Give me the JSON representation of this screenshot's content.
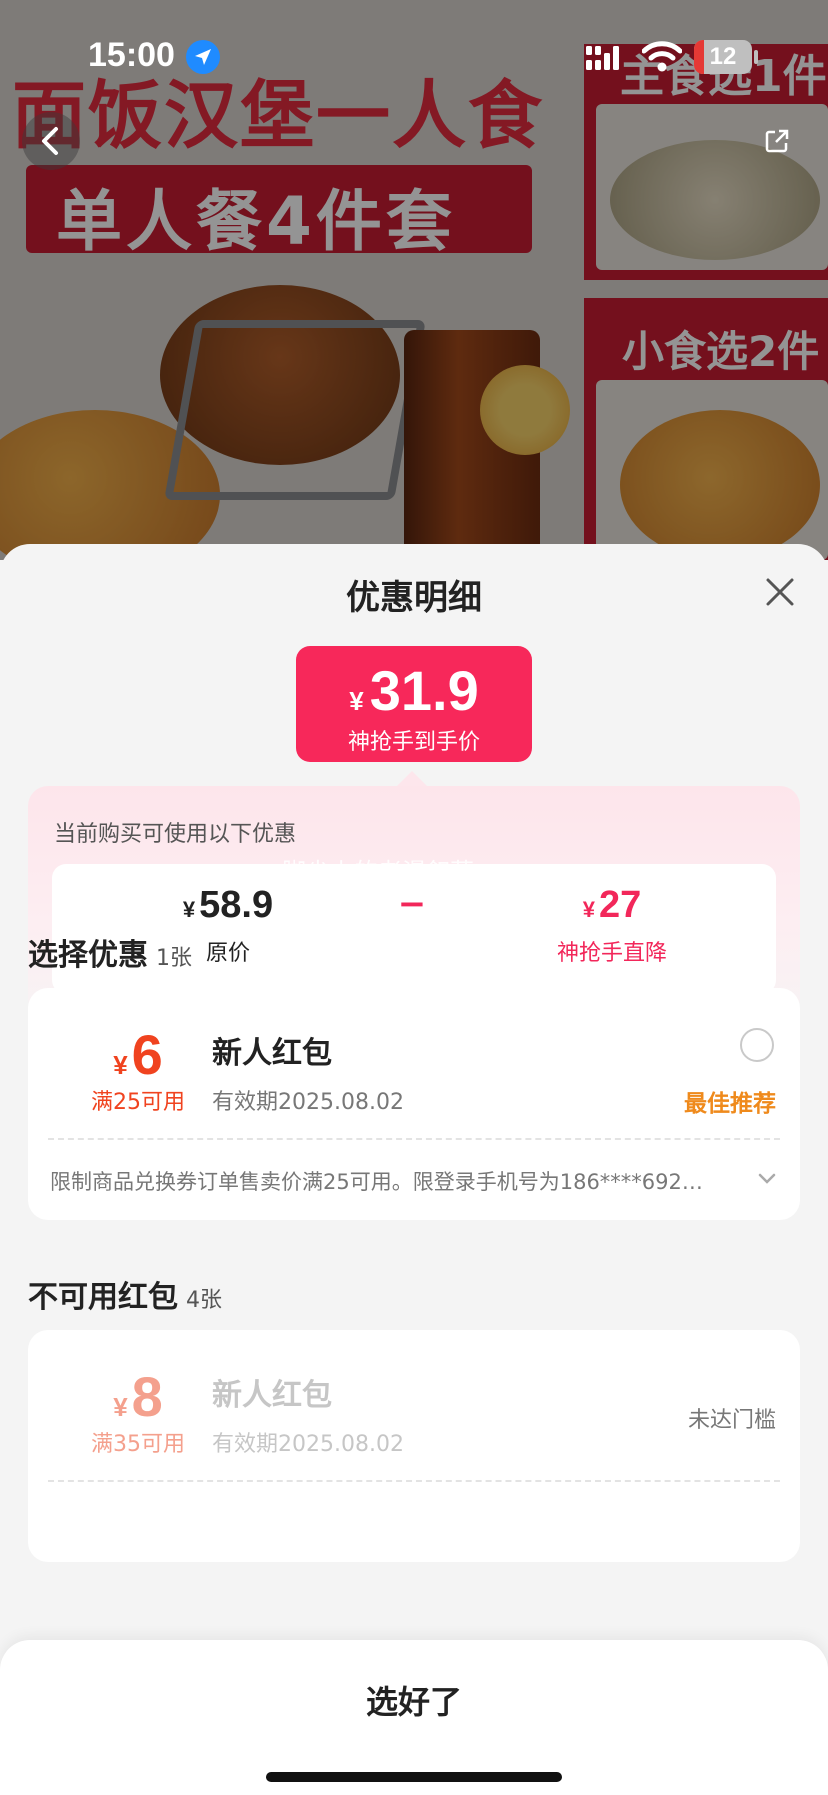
{
  "status_bar": {
    "time": "15:00",
    "battery": "12"
  },
  "banner": {
    "headline_1": "面饭汉堡一人食",
    "headline_2": "单人餐4件套",
    "panel_1": "主食选1件",
    "panel_2": "小食选2件"
  },
  "sheet": {
    "title": "优惠明细",
    "final_price": {
      "currency": "¥",
      "amount": "31.9",
      "label": "神抢手到手价"
    },
    "summary": {
      "hint": "当前购买可使用以下优惠",
      "watermark": "脚尖上的老漫叙菜",
      "original": {
        "currency": "¥",
        "amount": "58.9",
        "label": "原价"
      },
      "operator": "−",
      "discount": {
        "currency": "¥",
        "amount": "27",
        "label": "神抢手直降"
      }
    },
    "available": {
      "title": "选择优惠",
      "count": "1张",
      "coupon": {
        "currency": "¥",
        "amount": "6",
        "condition": "满25可用",
        "name": "新人红包",
        "validity": "有效期2025.08.02",
        "tag": "最佳推荐",
        "description": "限制商品兑换券订单售卖价满25可用。限登录手机号为186****6925..."
      }
    },
    "unavailable": {
      "title": "不可用红包",
      "count": "4张",
      "coupon": {
        "currency": "¥",
        "amount": "8",
        "condition": "满35可用",
        "name": "新人红包",
        "validity": "有效期2025.08.02",
        "tag": "未达门槛"
      }
    },
    "confirm_label": "选好了"
  },
  "colors": {
    "accent_pink": "#f7285a",
    "coupon_red": "#f0431f",
    "recommend_orange": "#ef8a1c"
  }
}
